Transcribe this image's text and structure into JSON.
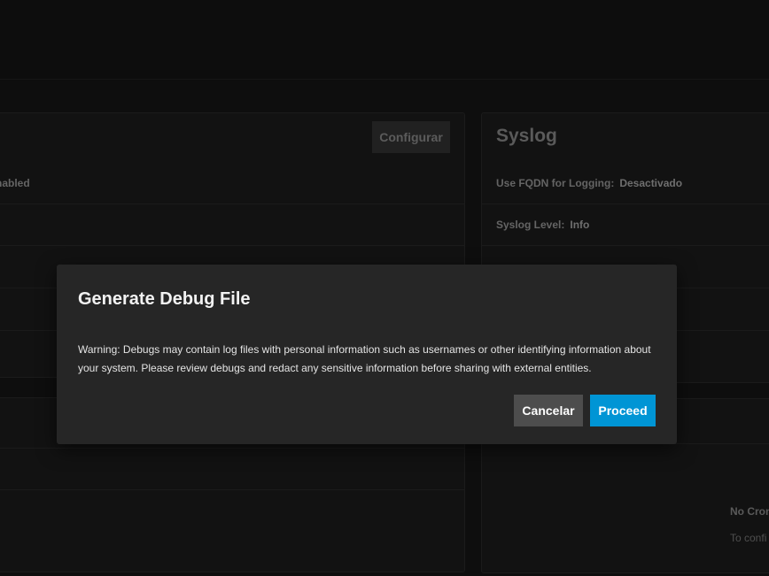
{
  "left_card": {
    "configure_label": "Configurar",
    "first_row_value": "nabled"
  },
  "syslog_card": {
    "title": "Syslog",
    "rows": [
      {
        "label": "Use FQDN for Logging:",
        "value": "Desactivado"
      },
      {
        "label": "Syslog Level:",
        "value": "Info"
      }
    ]
  },
  "cron_card": {
    "empty_title": "No Cron",
    "empty_subtitle": "To confi"
  },
  "dialog": {
    "title": "Generate Debug File",
    "message": "Warning: Debugs may contain log files with personal information such as usernames or other identifying information about your system. Please review debugs and redact any sensitive information before sharing with external entities.",
    "cancel_label": "Cancelar",
    "proceed_label": "Proceed"
  }
}
